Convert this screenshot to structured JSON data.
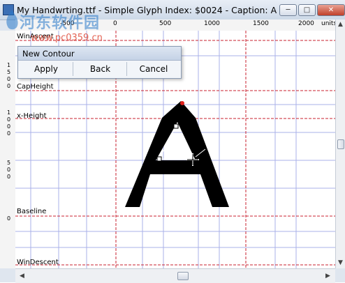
{
  "window": {
    "title": "My Handwrting.ttf - Simple Glyph Index: $0024 - Caption: A",
    "minimize_glyph": "─",
    "maximize_glyph": "□",
    "close_glyph": "✕"
  },
  "watermark": {
    "brand": "河东软件园",
    "url": "www.pc0359.cn"
  },
  "ruler": {
    "h_labels": [
      "-500",
      "0",
      "500",
      "1000",
      "1500",
      "2000",
      "units"
    ],
    "v_labels": [
      "1",
      "5",
      "0",
      "0",
      "1",
      "0",
      "0",
      "0",
      "5",
      "0",
      "0",
      "0"
    ]
  },
  "metrics": {
    "win_ascent": "WinAscent",
    "cap_height": "CapHeight",
    "x_height": "x-Height",
    "baseline": "Baseline",
    "win_descent": "WinDescent"
  },
  "popup": {
    "title": "New Contour",
    "apply": "Apply",
    "back": "Back",
    "cancel": "Cancel"
  },
  "scroll": {
    "up": "▲",
    "down": "▼",
    "left": "◀",
    "right": "▶"
  },
  "colors": {
    "grid": "#aab0e8",
    "metric_line": "#c8202f",
    "glyph_fill": "#000000",
    "start_point": "#e0201a"
  }
}
